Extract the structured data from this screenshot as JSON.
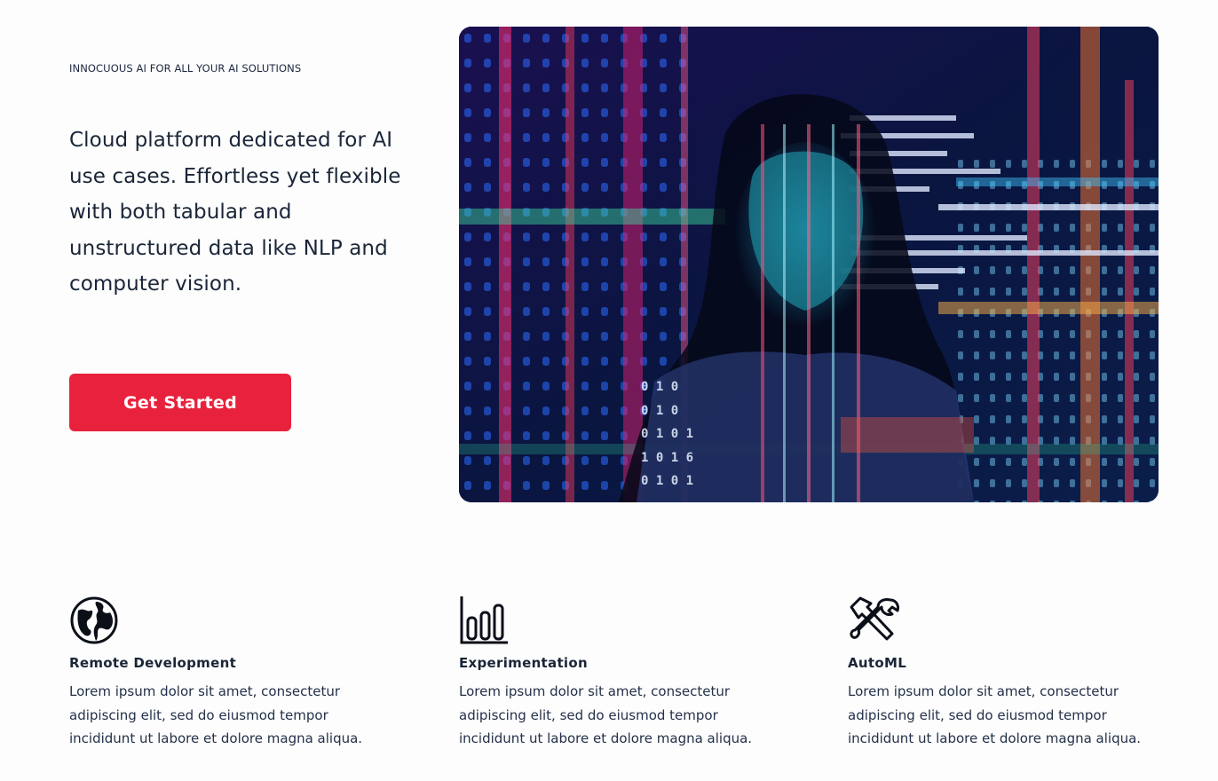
{
  "hero": {
    "eyebrow": "INNOCUOUS AI FOR ALL YOUR AI SOLUTIONS",
    "headline": "Cloud platform dedicated for AI use cases. Effortless yet flexible with both tabular and unstructured data like NLP and computer vision.",
    "cta_label": "Get Started",
    "image_alt": "Woman illuminated by projected code"
  },
  "features": [
    {
      "icon": "globe-icon",
      "title": "Remote Development",
      "text": "Lorem ipsum dolor sit amet, consectetur adipiscing elit, sed do eiusmod tempor incididunt ut labore et dolore magna aliqua."
    },
    {
      "icon": "bar-chart-icon",
      "title": "Experimentation",
      "text": "Lorem ipsum dolor sit amet, consectetur adipiscing elit, sed do eiusmod tempor incididunt ut labore et dolore magna aliqua."
    },
    {
      "icon": "tools-icon",
      "title": "AutoML",
      "text": "Lorem ipsum dolor sit amet, consectetur adipiscing elit, sed do eiusmod tempor incididunt ut labore et dolore magna aliqua."
    }
  ],
  "colors": {
    "accent": "#e8223d",
    "text": "#1a2538",
    "background": "#fcfdfc"
  }
}
